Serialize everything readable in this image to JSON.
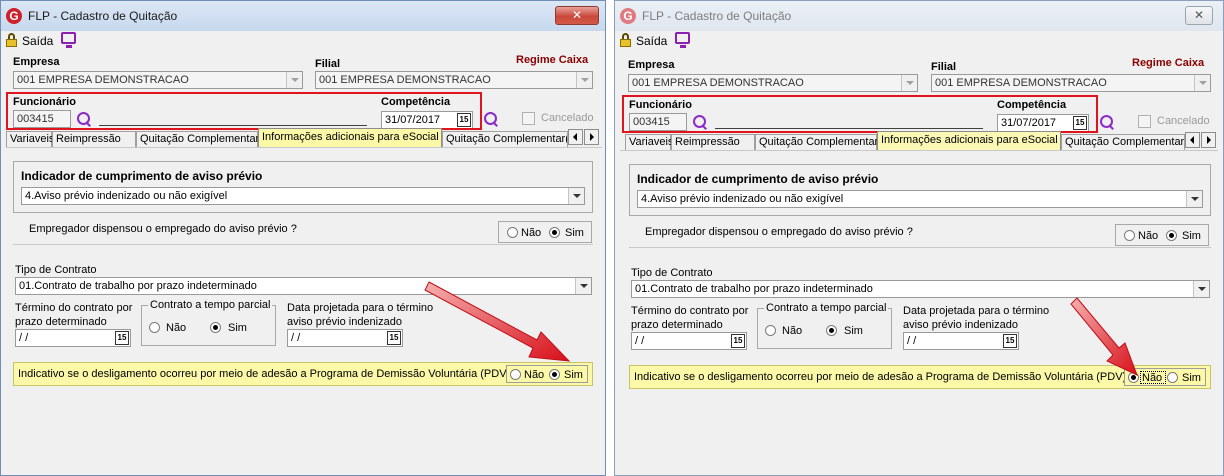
{
  "windows": [
    {
      "title": "FLP - Cadastro de Quitação",
      "close_label": "✕",
      "toolbar": {
        "exit_label": "Saída"
      },
      "empresa": {
        "label": "Empresa",
        "value": "001 EMPRESA DEMONSTRACAO"
      },
      "filial": {
        "label": "Filial",
        "value": "001 EMPRESA DEMONSTRACAO"
      },
      "regime": "Regime Caixa",
      "funcionario": {
        "label": "Funcionário",
        "value": "003415"
      },
      "competencia": {
        "label": "Competência",
        "value": "31/07/2017",
        "calendar_label": "15"
      },
      "cancelado_label": "Cancelado",
      "tabs": [
        "Variaveis",
        "Reimpressão",
        "Quitação Complementar",
        "Informações adicionais para eSocial",
        "Quitação Complementar(D"
      ],
      "selected_tab": 3,
      "aviso": {
        "title": "Indicador de cumprimento de aviso prévio",
        "value": "4.Aviso prévio indenizado ou não exigível"
      },
      "dispensou": {
        "question": "Empregador dispensou o empregado do aviso prévio ?",
        "no": "Não",
        "yes": "Sim",
        "selected": "Sim"
      },
      "contrato": {
        "label": "Tipo de Contrato",
        "value": "01.Contrato de trabalho por prazo indeterminado"
      },
      "termino": {
        "label_line1": "Término do contrato por",
        "label_line2": "prazo determinado",
        "value": " /  /"
      },
      "parcial": {
        "legend": "Contrato a tempo parcial",
        "no": "Não",
        "yes": "Sim",
        "selected": "Sim"
      },
      "projetada": {
        "label_line1": "Data projetada para o término",
        "label_line2": "aviso prévio indenizado",
        "value": " /  /"
      },
      "pdv": {
        "text": "Indicativo se o desligamento ocorreu por meio de adesão a Programa de Demissão Voluntária (PDV)",
        "no": "Não",
        "yes": "Sim",
        "selected": "Sim"
      }
    },
    {
      "title": "FLP - Cadastro de Quitação",
      "close_label": "✕",
      "toolbar": {
        "exit_label": "Saída"
      },
      "empresa": {
        "label": "Empresa",
        "value": "001 EMPRESA DEMONSTRACAO"
      },
      "filial": {
        "label": "Filial",
        "value": "001 EMPRESA DEMONSTRACAO"
      },
      "regime": "Regime Caixa",
      "funcionario": {
        "label": "Funcionário",
        "value": "003415"
      },
      "competencia": {
        "label": "Competência",
        "value": "31/07/2017",
        "calendar_label": "15"
      },
      "cancelado_label": "Cancelado",
      "tabs": [
        "Variaveis",
        "Reimpressão",
        "Quitação Complementar",
        "Informações adicionais para eSocial",
        "Quitação Complementar(D"
      ],
      "selected_tab": 3,
      "aviso": {
        "title": "Indicador de cumprimento de aviso prévio",
        "value": "4.Aviso prévio indenizado ou não exigível"
      },
      "dispensou": {
        "question": "Empregador dispensou o empregado do aviso prévio ?",
        "no": "Não",
        "yes": "Sim",
        "selected": "Sim"
      },
      "contrato": {
        "label": "Tipo de Contrato",
        "value": "01.Contrato de trabalho por prazo indeterminado"
      },
      "termino": {
        "label_line1": "Término do contrato por",
        "label_line2": "prazo determinado",
        "value": " /  /"
      },
      "parcial": {
        "legend": "Contrato a tempo parcial",
        "no": "Não",
        "yes": "Sim",
        "selected": "Sim"
      },
      "projetada": {
        "label_line1": "Data projetada para o término",
        "label_line2": "aviso prévio indenizado",
        "value": " /  /"
      },
      "pdv": {
        "text": "Indicativo se o desligamento ocorreu por meio de adesão a Programa de Demissão Voluntária (PDV)",
        "no": "Não",
        "yes": "Sim",
        "selected": "Não"
      }
    }
  ],
  "colors": {
    "highlight_box": "#e0141e",
    "annotation_arrow": "#e0141e",
    "selected_tab_bg": "#fbf8a8",
    "maroon_label": "#8b0000",
    "search_icon": "#8a2bc9"
  },
  "icons": [
    "app-logo-icon",
    "lock-icon",
    "monitor-icon",
    "search-icon",
    "calendar-icon",
    "chevron-down-icon",
    "close-icon",
    "arrow-left-icon",
    "arrow-right-icon",
    "annotation-arrow"
  ]
}
